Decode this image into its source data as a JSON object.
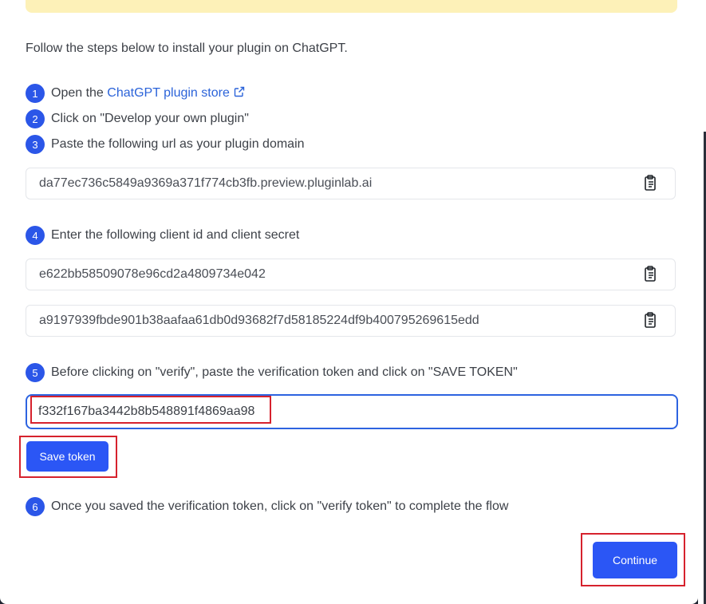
{
  "intro": "Follow the steps below to install your plugin on ChatGPT.",
  "steps": [
    {
      "num": "1",
      "prefix": "Open the ",
      "link": "ChatGPT plugin store"
    },
    {
      "num": "2",
      "text": "Click on \"Develop your own plugin\""
    },
    {
      "num": "3",
      "text": "Paste the following url as your plugin domain"
    },
    {
      "num": "4",
      "text": "Enter the following client id and client secret"
    },
    {
      "num": "5",
      "text": "Before clicking on \"verify\", paste the verification token and click on \"SAVE TOKEN\""
    },
    {
      "num": "6",
      "text": "Once you saved the verification token, click on \"verify token\" to complete the flow"
    }
  ],
  "fields": {
    "plugin_domain": "da77ec736c5849a9369a371f774cb3fb.preview.pluginlab.ai",
    "client_id": "e622bb58509078e96cd2a4809734e042",
    "client_secret": "a9197939fbde901b38aafaa61db0d93682f7d58185224df9b400795269615edd"
  },
  "token_input": {
    "value": "f332f167ba3442b8b548891f4869aa98"
  },
  "buttons": {
    "save_token": "Save token",
    "continue": "Continue"
  },
  "colors": {
    "accent": "#2b56f5",
    "highlight": "#d6222d",
    "banner": "#fdf1b8",
    "link": "#2b63d9"
  }
}
